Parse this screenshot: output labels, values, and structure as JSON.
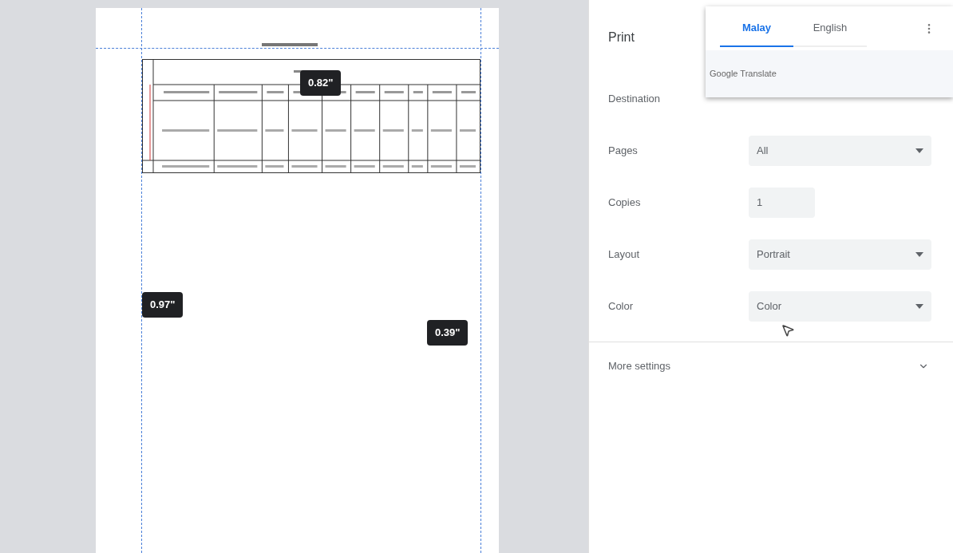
{
  "preview": {
    "margin_badges": [
      {
        "kind": "top",
        "text": "0.82\""
      },
      {
        "kind": "left",
        "text": "0.97\""
      },
      {
        "kind": "right",
        "text": "0.39\""
      }
    ]
  },
  "panel": {
    "title": "Print",
    "settings": [
      {
        "kind": "hidden",
        "label": "Destination"
      },
      {
        "kind": "select",
        "label": "Pages",
        "value": "All"
      },
      {
        "kind": "input",
        "label": "Copies",
        "value": "1"
      },
      {
        "kind": "select",
        "label": "Layout",
        "value": "Portrait"
      },
      {
        "kind": "select",
        "label": "Color",
        "value": "Color"
      }
    ],
    "more_settings": {
      "label": "More settings",
      "expanded": false
    }
  },
  "translate_popup": {
    "tabs": [
      {
        "label": "Malay",
        "selected": true
      },
      {
        "label": "English",
        "selected": false
      }
    ],
    "footer": "Google Translate"
  }
}
